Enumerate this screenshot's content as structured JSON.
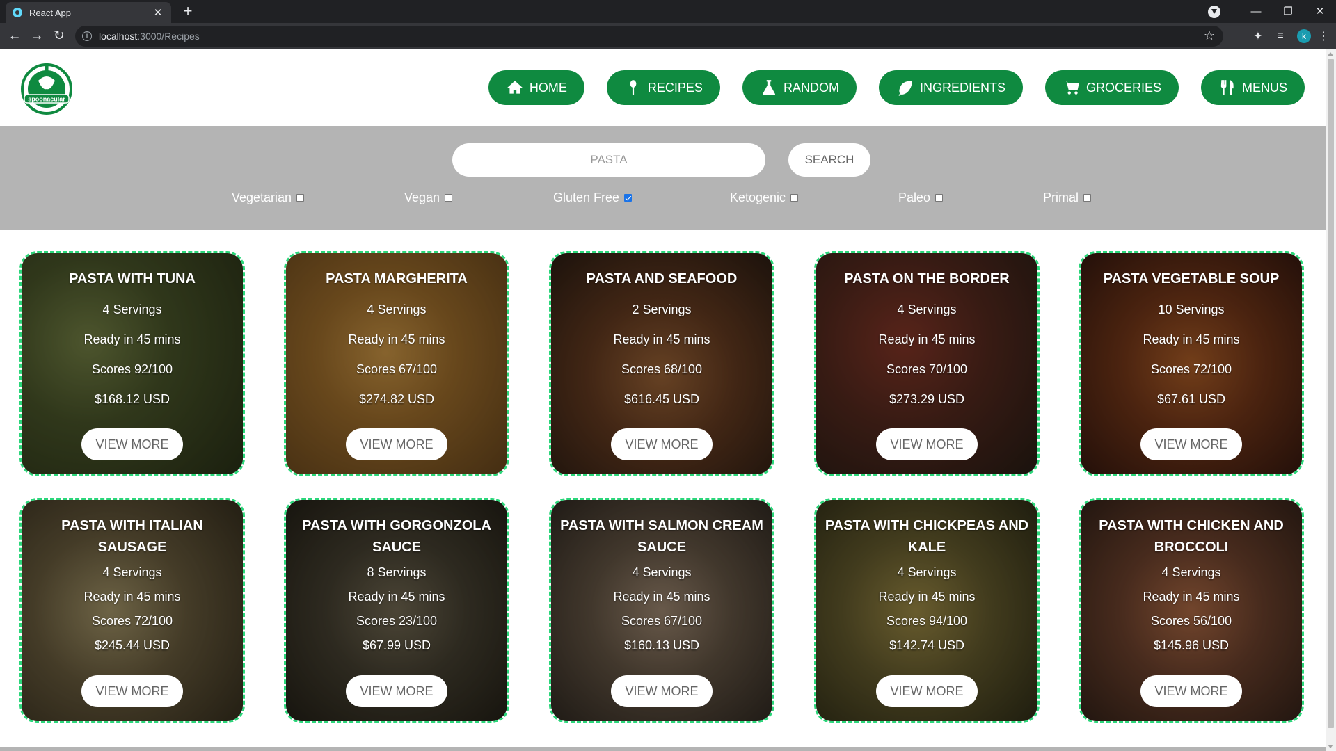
{
  "browser": {
    "tab_title": "React App",
    "url_host": "localhost",
    "url_path": ":3000/Recipes",
    "profile_initial": "k"
  },
  "header": {
    "logo_text": "spoonacular",
    "nav": [
      {
        "label": "HOME",
        "icon": "home-icon"
      },
      {
        "label": "RECIPES",
        "icon": "spoon-icon"
      },
      {
        "label": "RANDOM",
        "icon": "flask-icon"
      },
      {
        "label": "INGREDIENTS",
        "icon": "leaf-icon"
      },
      {
        "label": "GROCERIES",
        "icon": "cart-icon"
      },
      {
        "label": "MENUS",
        "icon": "utensils-icon"
      }
    ],
    "accent_color": "#0f8a40"
  },
  "search": {
    "placeholder": "PASTA",
    "button_label": "SEARCH",
    "filters": [
      {
        "label": "Vegetarian",
        "checked": false
      },
      {
        "label": "Vegan",
        "checked": false
      },
      {
        "label": "Gluten Free",
        "checked": true
      },
      {
        "label": "Ketogenic",
        "checked": false
      },
      {
        "label": "Paleo",
        "checked": false
      },
      {
        "label": "Primal",
        "checked": false
      }
    ]
  },
  "recipes": [
    {
      "title": "PASTA WITH TUNA",
      "servings": "4 Servings",
      "ready": "Ready in 45 mins",
      "score": "Scores 92/100",
      "price": "$168.12 USD",
      "button": "VIEW MORE"
    },
    {
      "title": "PASTA MARGHERITA",
      "servings": "4 Servings",
      "ready": "Ready in 45 mins",
      "score": "Scores 67/100",
      "price": "$274.82 USD",
      "button": "VIEW MORE"
    },
    {
      "title": "PASTA AND SEAFOOD",
      "servings": "2 Servings",
      "ready": "Ready in 45 mins",
      "score": "Scores 68/100",
      "price": "$616.45 USD",
      "button": "VIEW MORE"
    },
    {
      "title": "PASTA ON THE BORDER",
      "servings": "4 Servings",
      "ready": "Ready in 45 mins",
      "score": "Scores 70/100",
      "price": "$273.29 USD",
      "button": "VIEW MORE"
    },
    {
      "title": "PASTA VEGETABLE SOUP",
      "servings": "10 Servings",
      "ready": "Ready in 45 mins",
      "score": "Scores 72/100",
      "price": "$67.61 USD",
      "button": "VIEW MORE"
    },
    {
      "title": "PASTA WITH ITALIAN SAUSAGE",
      "servings": "4 Servings",
      "ready": "Ready in 45 mins",
      "score": "Scores 72/100",
      "price": "$245.44 USD",
      "button": "VIEW MORE"
    },
    {
      "title": "PASTA WITH GORGONZOLA SAUCE",
      "servings": "8 Servings",
      "ready": "Ready in 45 mins",
      "score": "Scores 23/100",
      "price": "$67.99 USD",
      "button": "VIEW MORE"
    },
    {
      "title": "PASTA WITH SALMON CREAM SAUCE",
      "servings": "4 Servings",
      "ready": "Ready in 45 mins",
      "score": "Scores 67/100",
      "price": "$160.13 USD",
      "button": "VIEW MORE"
    },
    {
      "title": "PASTA WITH CHICKPEAS AND KALE",
      "servings": "4 Servings",
      "ready": "Ready in 45 mins",
      "score": "Scores 94/100",
      "price": "$142.74 USD",
      "button": "VIEW MORE"
    },
    {
      "title": "PASTA WITH CHICKEN AND BROCCOLI",
      "servings": "4 Servings",
      "ready": "Ready in 45 mins",
      "score": "Scores 56/100",
      "price": "$145.96 USD",
      "button": "VIEW MORE"
    }
  ]
}
